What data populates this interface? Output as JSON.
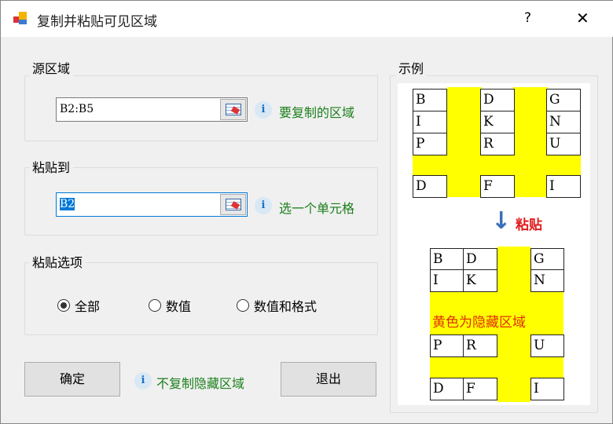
{
  "window": {
    "title": "复制并粘贴可见区域",
    "help": "?",
    "close": "✕"
  },
  "source": {
    "label": "源区域",
    "value": "B2:B5",
    "hint": "要复制的区域"
  },
  "paste_to": {
    "label": "粘贴到",
    "value": "B2",
    "hint": "选一个单元格"
  },
  "options": {
    "label": "粘贴选项",
    "items": [
      {
        "label": "全部",
        "checked": true
      },
      {
        "label": "数值",
        "checked": false
      },
      {
        "label": "数值和格式",
        "checked": false
      }
    ]
  },
  "ok_label": "确定",
  "note": "不复制隐藏区域",
  "exit_label": "退出",
  "example": {
    "label": "示例",
    "paste_text": "粘贴",
    "hidden_text": "黄色为隐藏区域",
    "before": [
      [
        "B",
        "D",
        "G"
      ],
      [
        "I",
        "K",
        "N"
      ],
      [
        "P",
        "R",
        "U"
      ],
      [
        "D",
        "F",
        "I"
      ]
    ],
    "after": [
      [
        "B",
        "D",
        "G"
      ],
      [
        "I",
        "K",
        "N"
      ],
      [
        "P",
        "R",
        "U"
      ],
      [
        "D",
        "F",
        "I"
      ]
    ]
  }
}
